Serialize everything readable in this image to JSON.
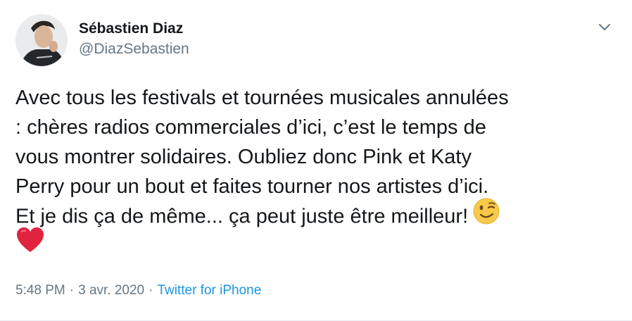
{
  "author": {
    "name": "Sébastien Diaz",
    "handle": "@DiazSebastien"
  },
  "tweet": {
    "lines": [
      "Avec tous les festivals et tournées musicales annulées",
      ": chères radios commerciales d’ici, c’est le temps de",
      "vous montrer solidaires. Oubliez donc Pink et Katy",
      "Perry pour un bout et faites tourner nos artistes d’ici.",
      "Et je dis ça de même... ça peut juste être meilleur!"
    ],
    "emojis": [
      "winking-face-emoji",
      "red-heart-emoji"
    ]
  },
  "meta": {
    "time": "5:48 PM",
    "separator": "·",
    "date": "3 avr. 2020",
    "source": "Twitter for iPhone"
  },
  "icons": {
    "menu": "chevron-down-icon"
  },
  "colors": {
    "text": "#14171a",
    "secondary": "#657786",
    "link": "#1b95e0"
  }
}
